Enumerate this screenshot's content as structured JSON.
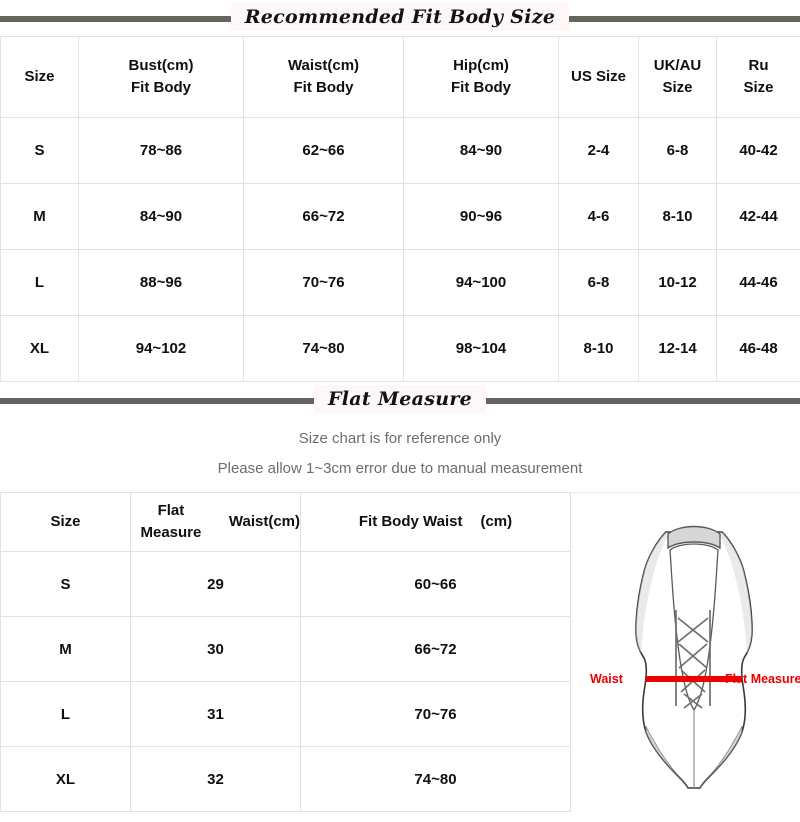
{
  "sections": {
    "fit_body": {
      "title": "Recommended Fit Body Size"
    },
    "flat_measure": {
      "title": "Flat Measure"
    }
  },
  "notes": [
    "Size chart is for reference only",
    "Please allow 1~3cm error due to manual measurement"
  ],
  "fit_body_table": {
    "headers": {
      "size": "Size",
      "bust_l1": "Bust(cm)",
      "bust_l2": "Fit Body",
      "waist_l1": "Waist(cm)",
      "waist_l2": "Fit Body",
      "hip_l1": "Hip(cm)",
      "hip_l2": "Fit Body",
      "us": "US  Size",
      "uk_l1": "UK/AU",
      "uk_l2": "Size",
      "ru_l1": "Ru",
      "ru_l2": "Size"
    },
    "rows": [
      {
        "size": "S",
        "bust": "78~86",
        "waist": "62~66",
        "hip": "84~90",
        "us": "2-4",
        "uk": "6-8",
        "ru": "40-42"
      },
      {
        "size": "M",
        "bust": "84~90",
        "waist": "66~72",
        "hip": "90~96",
        "us": "4-6",
        "uk": "8-10",
        "ru": "42-44"
      },
      {
        "size": "L",
        "bust": "88~96",
        "waist": "70~76",
        "hip": "94~100",
        "us": "6-8",
        "uk": "10-12",
        "ru": "44-46"
      },
      {
        "size": "XL",
        "bust": "94~102",
        "waist": "74~80",
        "hip": "98~104",
        "us": "8-10",
        "uk": "12-14",
        "ru": "46-48"
      }
    ]
  },
  "flat_measure_table": {
    "headers": {
      "size": "Size",
      "flat_a": "Flat Measure",
      "flat_b": "Waist(cm)",
      "fit_a": "Fit Body Waist",
      "fit_b": "(cm)"
    },
    "rows": [
      {
        "size": "S",
        "flat": "29",
        "fit": "60~66"
      },
      {
        "size": "M",
        "flat": "30",
        "fit": "66~72"
      },
      {
        "size": "L",
        "flat": "31",
        "fit": "70~76"
      },
      {
        "size": "XL",
        "flat": "32",
        "fit": "74~80"
      }
    ]
  },
  "figure": {
    "label_left": "Waist",
    "label_right": "Flat Measure",
    "accent_color": "#ee0000",
    "garment": "one-piece-swimsuit-lace-up-front"
  },
  "colors": {
    "rule": "#66645f",
    "grid": "#e2e2e2",
    "note_text": "#6d6d6d",
    "accent": "#ee0000"
  }
}
